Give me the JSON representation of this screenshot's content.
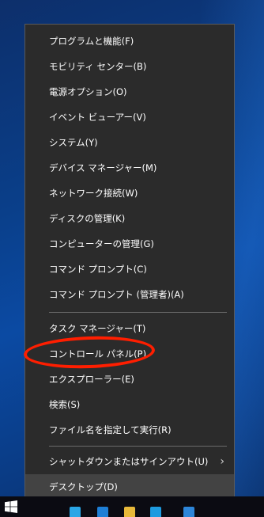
{
  "menu": {
    "items": [
      {
        "label": "プログラムと機能(F)"
      },
      {
        "label": "モビリティ センター(B)"
      },
      {
        "label": "電源オプション(O)"
      },
      {
        "label": "イベント ビューアー(V)"
      },
      {
        "label": "システム(Y)"
      },
      {
        "label": "デバイス マネージャー(M)"
      },
      {
        "label": "ネットワーク接続(W)"
      },
      {
        "label": "ディスクの管理(K)"
      },
      {
        "label": "コンピューターの管理(G)"
      },
      {
        "label": "コマンド プロンプト(C)"
      },
      {
        "label": "コマンド プロンプト (管理者)(A)"
      },
      {
        "label": "タスク マネージャー(T)"
      },
      {
        "label": "コントロール パネル(P)"
      },
      {
        "label": "エクスプローラー(E)"
      },
      {
        "label": "検索(S)"
      },
      {
        "label": "ファイル名を指定して実行(R)"
      },
      {
        "label": "シャットダウンまたはサインアウト(U)",
        "submenu": true
      },
      {
        "label": "デスクトップ(D)"
      }
    ],
    "hovered_item": "デスクトップ(D)",
    "annotated_item": "コントロール パネル(P)"
  },
  "icons": {
    "submenu": "chevron-right-icon",
    "start": "windows-logo-icon"
  },
  "colors": {
    "menu_background": "#2b2b2b",
    "menu_text": "#ffffff",
    "hover_background": "#434343",
    "separator": "#6b6b6b",
    "annotation": "#ff1e00",
    "taskbar": "#0b0b12",
    "desktop": "#0b4aa3"
  }
}
